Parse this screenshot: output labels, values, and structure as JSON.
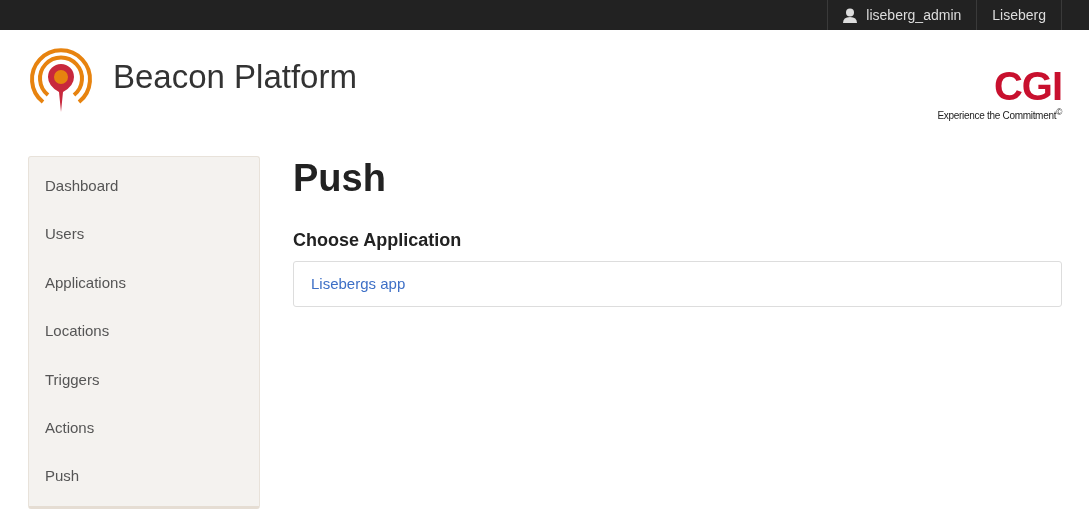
{
  "top_bar": {
    "user": "liseberg_admin",
    "organization": "Liseberg"
  },
  "header": {
    "title": "Beacon Platform",
    "brand": "CGI",
    "tagline": "Experience the Commitment$^{©}$"
  },
  "sidebar": {
    "items": [
      {
        "label": "Dashboard"
      },
      {
        "label": "Users"
      },
      {
        "label": "Applications"
      },
      {
        "label": "Locations"
      },
      {
        "label": "Triggers"
      },
      {
        "label": "Actions"
      },
      {
        "label": "Push"
      }
    ]
  },
  "main": {
    "heading": "Push",
    "subheading": "Choose Application",
    "applications": [
      {
        "label": "Lisebergs app"
      }
    ]
  }
}
